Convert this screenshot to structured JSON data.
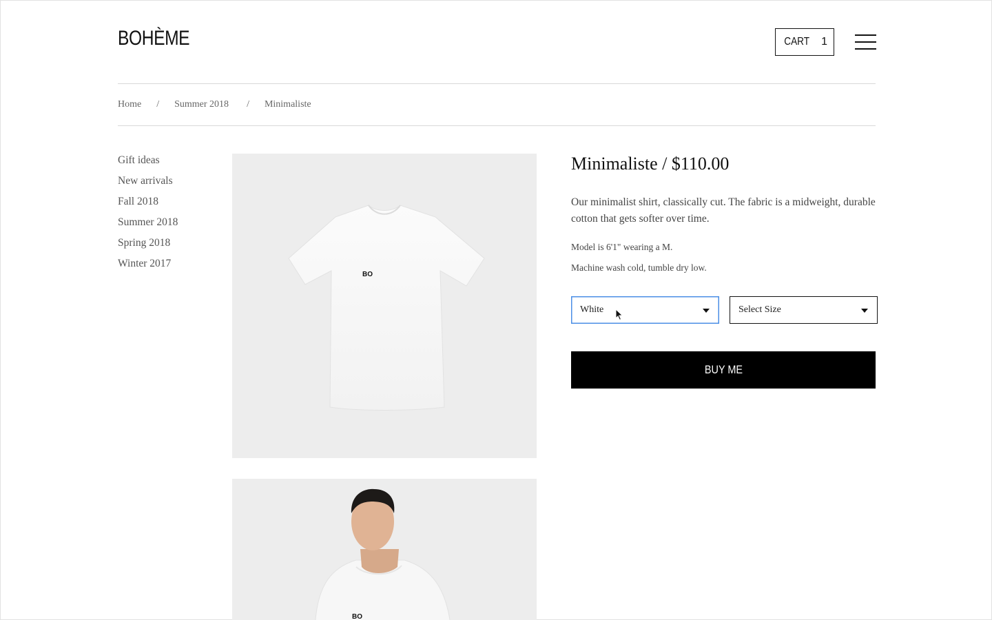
{
  "header": {
    "logo": "BOHÈME",
    "cart_label": "CART",
    "cart_count": "1"
  },
  "breadcrumb": [
    {
      "label": "Home"
    },
    {
      "label": "Summer 2018"
    },
    {
      "label": "Minimaliste"
    }
  ],
  "breadcrumb_separator": "/",
  "sidebar": {
    "items": [
      {
        "label": "Gift ideas"
      },
      {
        "label": "New arrivals"
      },
      {
        "label": "Fall 2018"
      },
      {
        "label": "Summer 2018"
      },
      {
        "label": "Spring 2018"
      },
      {
        "label": "Winter 2017"
      }
    ]
  },
  "product": {
    "title": "Minimaliste / $110.00",
    "description": "Our minimalist shirt, classically cut. The fabric is a midweight, durable cotton that gets softer over time.",
    "model_note": "Model is 6'1\" wearing a M.",
    "care_note": "Machine wash cold, tumble dry low.",
    "shirt_print": "BO",
    "color_select": "White",
    "size_select": "Select Size",
    "buy_label": "BUY ME"
  },
  "colors": {
    "accent_focus": "#4a8ee6",
    "button_bg": "#000000",
    "image_bg": "#ededed"
  }
}
